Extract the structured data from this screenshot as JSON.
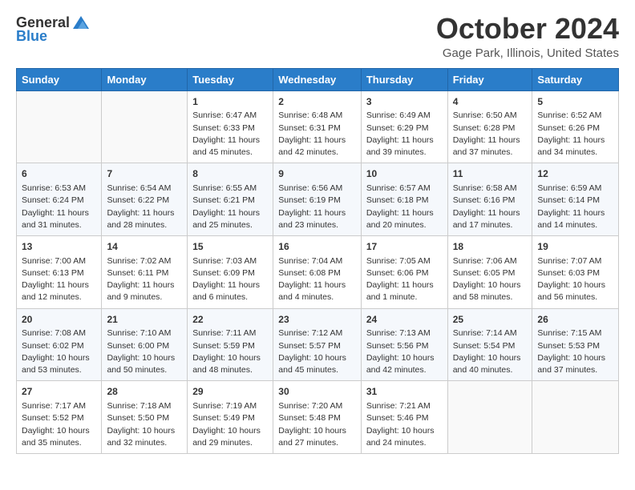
{
  "header": {
    "logo_general": "General",
    "logo_blue": "Blue",
    "month": "October 2024",
    "location": "Gage Park, Illinois, United States"
  },
  "columns": [
    "Sunday",
    "Monday",
    "Tuesday",
    "Wednesday",
    "Thursday",
    "Friday",
    "Saturday"
  ],
  "weeks": [
    [
      {
        "num": "",
        "sunrise": "",
        "sunset": "",
        "daylight": ""
      },
      {
        "num": "",
        "sunrise": "",
        "sunset": "",
        "daylight": ""
      },
      {
        "num": "1",
        "sunrise": "Sunrise: 6:47 AM",
        "sunset": "Sunset: 6:33 PM",
        "daylight": "Daylight: 11 hours and 45 minutes."
      },
      {
        "num": "2",
        "sunrise": "Sunrise: 6:48 AM",
        "sunset": "Sunset: 6:31 PM",
        "daylight": "Daylight: 11 hours and 42 minutes."
      },
      {
        "num": "3",
        "sunrise": "Sunrise: 6:49 AM",
        "sunset": "Sunset: 6:29 PM",
        "daylight": "Daylight: 11 hours and 39 minutes."
      },
      {
        "num": "4",
        "sunrise": "Sunrise: 6:50 AM",
        "sunset": "Sunset: 6:28 PM",
        "daylight": "Daylight: 11 hours and 37 minutes."
      },
      {
        "num": "5",
        "sunrise": "Sunrise: 6:52 AM",
        "sunset": "Sunset: 6:26 PM",
        "daylight": "Daylight: 11 hours and 34 minutes."
      }
    ],
    [
      {
        "num": "6",
        "sunrise": "Sunrise: 6:53 AM",
        "sunset": "Sunset: 6:24 PM",
        "daylight": "Daylight: 11 hours and 31 minutes."
      },
      {
        "num": "7",
        "sunrise": "Sunrise: 6:54 AM",
        "sunset": "Sunset: 6:22 PM",
        "daylight": "Daylight: 11 hours and 28 minutes."
      },
      {
        "num": "8",
        "sunrise": "Sunrise: 6:55 AM",
        "sunset": "Sunset: 6:21 PM",
        "daylight": "Daylight: 11 hours and 25 minutes."
      },
      {
        "num": "9",
        "sunrise": "Sunrise: 6:56 AM",
        "sunset": "Sunset: 6:19 PM",
        "daylight": "Daylight: 11 hours and 23 minutes."
      },
      {
        "num": "10",
        "sunrise": "Sunrise: 6:57 AM",
        "sunset": "Sunset: 6:18 PM",
        "daylight": "Daylight: 11 hours and 20 minutes."
      },
      {
        "num": "11",
        "sunrise": "Sunrise: 6:58 AM",
        "sunset": "Sunset: 6:16 PM",
        "daylight": "Daylight: 11 hours and 17 minutes."
      },
      {
        "num": "12",
        "sunrise": "Sunrise: 6:59 AM",
        "sunset": "Sunset: 6:14 PM",
        "daylight": "Daylight: 11 hours and 14 minutes."
      }
    ],
    [
      {
        "num": "13",
        "sunrise": "Sunrise: 7:00 AM",
        "sunset": "Sunset: 6:13 PM",
        "daylight": "Daylight: 11 hours and 12 minutes."
      },
      {
        "num": "14",
        "sunrise": "Sunrise: 7:02 AM",
        "sunset": "Sunset: 6:11 PM",
        "daylight": "Daylight: 11 hours and 9 minutes."
      },
      {
        "num": "15",
        "sunrise": "Sunrise: 7:03 AM",
        "sunset": "Sunset: 6:09 PM",
        "daylight": "Daylight: 11 hours and 6 minutes."
      },
      {
        "num": "16",
        "sunrise": "Sunrise: 7:04 AM",
        "sunset": "Sunset: 6:08 PM",
        "daylight": "Daylight: 11 hours and 4 minutes."
      },
      {
        "num": "17",
        "sunrise": "Sunrise: 7:05 AM",
        "sunset": "Sunset: 6:06 PM",
        "daylight": "Daylight: 11 hours and 1 minute."
      },
      {
        "num": "18",
        "sunrise": "Sunrise: 7:06 AM",
        "sunset": "Sunset: 6:05 PM",
        "daylight": "Daylight: 10 hours and 58 minutes."
      },
      {
        "num": "19",
        "sunrise": "Sunrise: 7:07 AM",
        "sunset": "Sunset: 6:03 PM",
        "daylight": "Daylight: 10 hours and 56 minutes."
      }
    ],
    [
      {
        "num": "20",
        "sunrise": "Sunrise: 7:08 AM",
        "sunset": "Sunset: 6:02 PM",
        "daylight": "Daylight: 10 hours and 53 minutes."
      },
      {
        "num": "21",
        "sunrise": "Sunrise: 7:10 AM",
        "sunset": "Sunset: 6:00 PM",
        "daylight": "Daylight: 10 hours and 50 minutes."
      },
      {
        "num": "22",
        "sunrise": "Sunrise: 7:11 AM",
        "sunset": "Sunset: 5:59 PM",
        "daylight": "Daylight: 10 hours and 48 minutes."
      },
      {
        "num": "23",
        "sunrise": "Sunrise: 7:12 AM",
        "sunset": "Sunset: 5:57 PM",
        "daylight": "Daylight: 10 hours and 45 minutes."
      },
      {
        "num": "24",
        "sunrise": "Sunrise: 7:13 AM",
        "sunset": "Sunset: 5:56 PM",
        "daylight": "Daylight: 10 hours and 42 minutes."
      },
      {
        "num": "25",
        "sunrise": "Sunrise: 7:14 AM",
        "sunset": "Sunset: 5:54 PM",
        "daylight": "Daylight: 10 hours and 40 minutes."
      },
      {
        "num": "26",
        "sunrise": "Sunrise: 7:15 AM",
        "sunset": "Sunset: 5:53 PM",
        "daylight": "Daylight: 10 hours and 37 minutes."
      }
    ],
    [
      {
        "num": "27",
        "sunrise": "Sunrise: 7:17 AM",
        "sunset": "Sunset: 5:52 PM",
        "daylight": "Daylight: 10 hours and 35 minutes."
      },
      {
        "num": "28",
        "sunrise": "Sunrise: 7:18 AM",
        "sunset": "Sunset: 5:50 PM",
        "daylight": "Daylight: 10 hours and 32 minutes."
      },
      {
        "num": "29",
        "sunrise": "Sunrise: 7:19 AM",
        "sunset": "Sunset: 5:49 PM",
        "daylight": "Daylight: 10 hours and 29 minutes."
      },
      {
        "num": "30",
        "sunrise": "Sunrise: 7:20 AM",
        "sunset": "Sunset: 5:48 PM",
        "daylight": "Daylight: 10 hours and 27 minutes."
      },
      {
        "num": "31",
        "sunrise": "Sunrise: 7:21 AM",
        "sunset": "Sunset: 5:46 PM",
        "daylight": "Daylight: 10 hours and 24 minutes."
      },
      {
        "num": "",
        "sunrise": "",
        "sunset": "",
        "daylight": ""
      },
      {
        "num": "",
        "sunrise": "",
        "sunset": "",
        "daylight": ""
      }
    ]
  ]
}
